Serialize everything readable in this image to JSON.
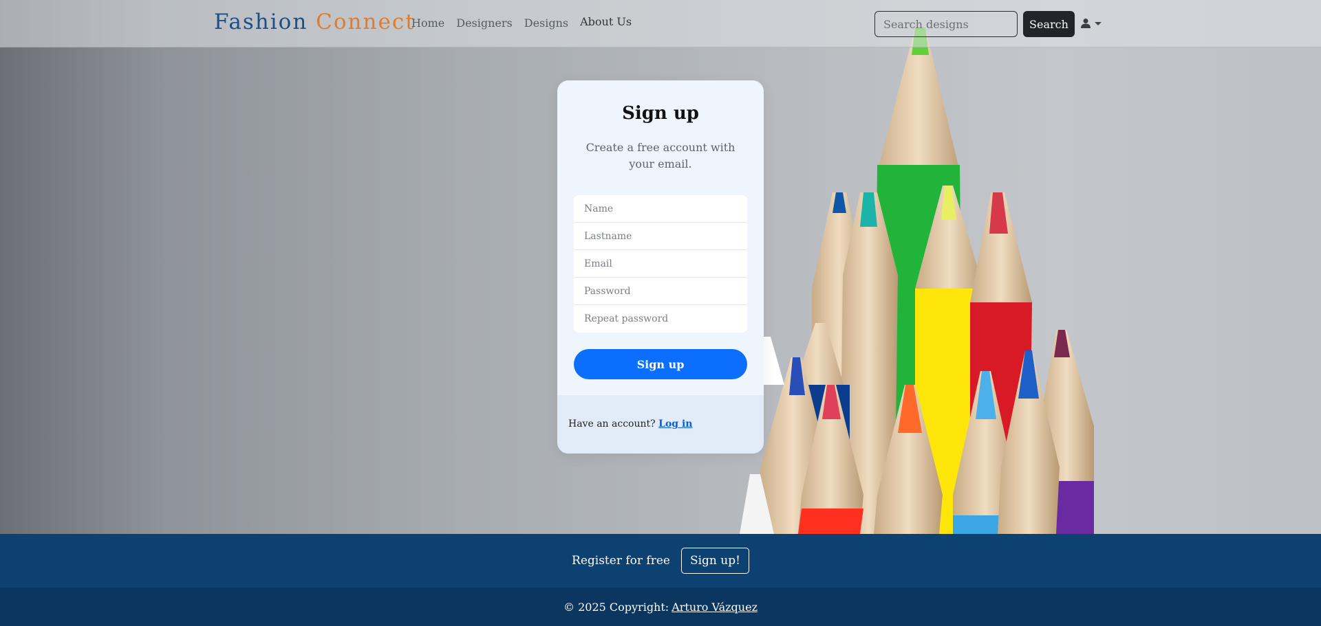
{
  "navbar": {
    "brand_part1": "Fashion",
    "brand_part2": "Connect",
    "links": [
      "Home",
      "Designers",
      "Designs",
      "About Us"
    ],
    "search_placeholder": "Search designs",
    "search_button": "Search",
    "user_icon": "user-icon"
  },
  "card": {
    "title": "Sign up",
    "subtitle": "Create a free account with your email.",
    "fields": {
      "name_placeholder": "Name",
      "lastname_placeholder": "Lastname",
      "email_placeholder": "Email",
      "password_placeholder": "Password",
      "repeat_password_placeholder": "Repeat password"
    },
    "submit_label": "Sign up",
    "have_account_text": "Have an account?",
    "login_link": "Log in"
  },
  "footer": {
    "register_text": "Register for free",
    "register_button": "Sign up!",
    "copyright_text": "© 2025 Copyright:",
    "copyright_link": "Arturo Vázquez"
  },
  "colors": {
    "brand_primary": "#1c4f86",
    "brand_accent": "#e07c2c",
    "button_blue": "#0b6efd",
    "footer_top": "#0c4172",
    "footer_bottom": "#0b365f"
  }
}
